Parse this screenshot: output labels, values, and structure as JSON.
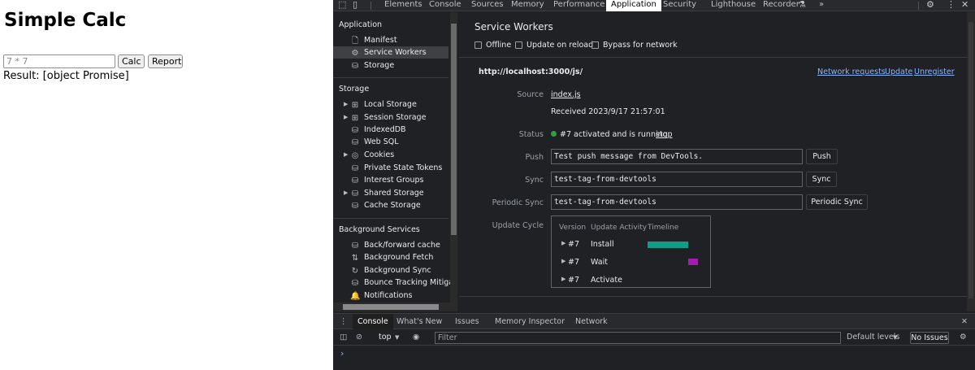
{
  "page": {
    "title": "Simple Calc",
    "input_placeholder": "7 * 7",
    "calc_label": "Calc",
    "report_label": "Report",
    "result_text": "Result: [object Promise]"
  },
  "devtools": {
    "top_tabs": [
      "Elements",
      "Console",
      "Sources",
      "Memory",
      "Performance",
      "Application",
      "Security",
      "Lighthouse",
      "Recorder",
      "»"
    ],
    "active_tab": "Application",
    "sidebar": {
      "application_header": "Application",
      "application_items": [
        {
          "label": "Manifest",
          "icon": "file-icon"
        },
        {
          "label": "Service Workers",
          "icon": "gears-icon"
        },
        {
          "label": "Storage",
          "icon": "database-icon"
        }
      ],
      "storage_header": "Storage",
      "storage_items": [
        {
          "label": "Local Storage",
          "icon": "grid-icon"
        },
        {
          "label": "Session Storage",
          "icon": "grid-icon"
        },
        {
          "label": "IndexedDB",
          "icon": "database-icon"
        },
        {
          "label": "Web SQL",
          "icon": "database-icon"
        },
        {
          "label": "Cookies",
          "icon": "cookie-icon"
        },
        {
          "label": "Private State Tokens",
          "icon": "database-icon"
        },
        {
          "label": "Interest Groups",
          "icon": "database-icon"
        },
        {
          "label": "Shared Storage",
          "icon": "database-icon"
        },
        {
          "label": "Cache Storage",
          "icon": "database-icon"
        }
      ],
      "background_header": "Background Services",
      "background_items": [
        {
          "label": "Back/forward cache",
          "icon": "database-icon"
        },
        {
          "label": "Background Fetch",
          "icon": "arrows-updown-icon"
        },
        {
          "label": "Background Sync",
          "icon": "sync-icon"
        },
        {
          "label": "Bounce Tracking Mitigations",
          "icon": "database-icon"
        },
        {
          "label": "Notifications",
          "icon": "bell-icon"
        }
      ]
    },
    "service_workers": {
      "title": "Service Workers",
      "checkboxes": [
        "Offline",
        "Update on reload",
        "Bypass for network"
      ],
      "origin": "http://localhost:3000/js/",
      "links": [
        "Network requests",
        "Update",
        "Unregister"
      ],
      "source_label": "Source",
      "source_file": "index.js",
      "received": "Received 2023/9/17 21:57:01",
      "status_label": "Status",
      "status_text": "#7 activated and is running",
      "stop_label": "stop",
      "push_label": "Push",
      "push_value": "Test push message from DevTools.",
      "push_button": "Push",
      "sync_label": "Sync",
      "sync_value": "test-tag-from-devtools",
      "sync_button": "Sync",
      "periodic_label": "Periodic Sync",
      "periodic_value": "test-tag-from-devtools",
      "periodic_button": "Periodic Sync",
      "update_cycle_label": "Update Cycle",
      "cycle_headers": [
        "Version",
        "Update Activity",
        "Timeline"
      ],
      "cycle_rows": [
        {
          "version": "#7",
          "activity": "Install",
          "color": "#0f9d8a"
        },
        {
          "version": "#7",
          "activity": "Wait",
          "color": "#a21caf"
        },
        {
          "version": "#7",
          "activity": "Activate",
          "color": ""
        }
      ]
    },
    "drawer": {
      "tabs": [
        "Console",
        "What's New",
        "Issues",
        "Memory Inspector",
        "Network"
      ],
      "active_tab": "Console",
      "context": "top",
      "filter_placeholder": "Filter",
      "levels": "Default levels",
      "issues": "No Issues",
      "prompt": "›"
    }
  }
}
